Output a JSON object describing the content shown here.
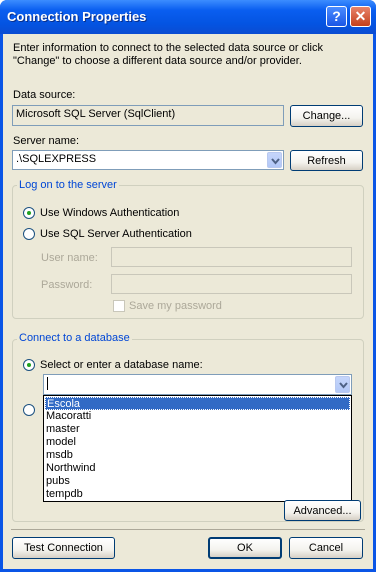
{
  "window": {
    "title": "Connection Properties",
    "help_label": "?",
    "close_label": "✕"
  },
  "intro_text_line1": "Enter information to connect to the selected data source or click",
  "intro_text_line2": "\"Change\" to choose a different data source and/or provider.",
  "data_source": {
    "label": "Data source:",
    "value": "Microsoft SQL Server (SqlClient)",
    "change_label": "Change..."
  },
  "server_name": {
    "label": "Server name:",
    "value": ".\\SQLEXPRESS",
    "refresh_label": "Refresh"
  },
  "logon": {
    "group_title": "Log on to the server",
    "windows_auth_label": "Use Windows Authentication",
    "sql_auth_label": "Use SQL Server Authentication",
    "selected": "windows",
    "user_name_label": "User name:",
    "password_label": "Password:",
    "save_password_label": "Save my password"
  },
  "database": {
    "group_title": "Connect to a database",
    "select_label": "Select or enter a database name:",
    "value": "",
    "options": [
      "Escola",
      "Macoratti",
      "master",
      "model",
      "msdb",
      "Northwind",
      "pubs",
      "tempdb"
    ],
    "highlighted": "Escola"
  },
  "buttons": {
    "advanced_label": "Advanced...",
    "test_label": "Test Connection",
    "ok_label": "OK",
    "cancel_label": "Cancel"
  },
  "colors": {
    "title_bar": "#0a5ef0",
    "dialog_bg": "#ece9d8",
    "group_title": "#0046d5",
    "selection": "#316ac5"
  }
}
